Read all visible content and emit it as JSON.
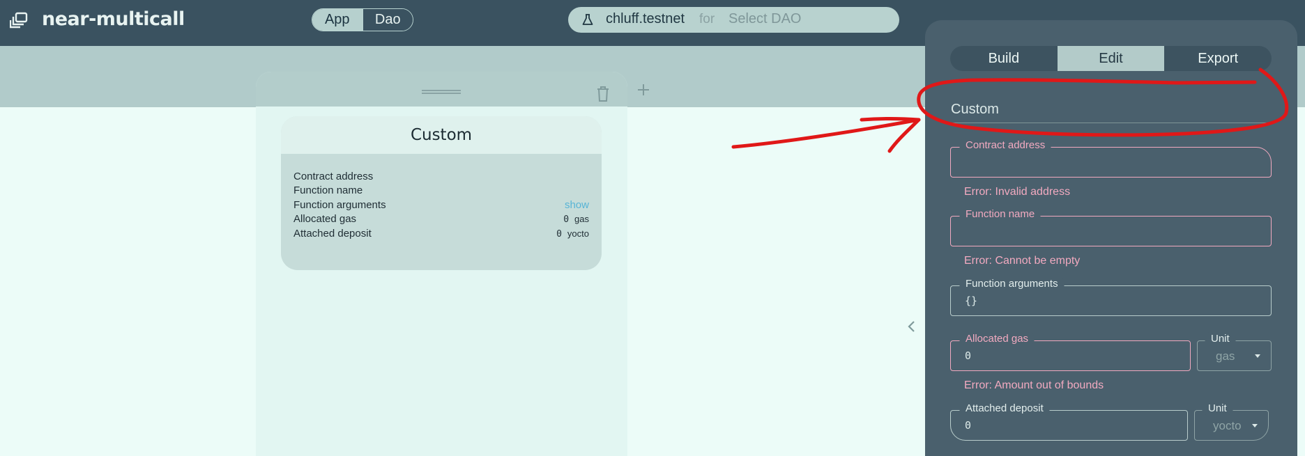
{
  "header": {
    "app_title": "near-multicall",
    "mode_toggle": {
      "app_label": "App",
      "dao_label": "Dao",
      "active": "App"
    },
    "wallet": {
      "account": "chluff.testnet",
      "for_label": "for",
      "dao_placeholder": "Select DAO"
    }
  },
  "column": {
    "task_card": {
      "title": "Custom",
      "rows": {
        "contract_address": "Contract address",
        "function_name": "Function name",
        "function_arguments": "Function arguments",
        "function_arguments_link": "show",
        "allocated_gas": "Allocated gas",
        "allocated_gas_value": "0",
        "allocated_gas_unit": "gas",
        "attached_deposit": "Attached deposit",
        "attached_deposit_value": "0",
        "attached_deposit_unit": "yocto"
      }
    }
  },
  "panel": {
    "tabs": {
      "build": "Build",
      "edit": "Edit",
      "export": "Export",
      "active": "Edit"
    },
    "title": "Custom",
    "fields": {
      "contract_address": {
        "label": "Contract address",
        "value": "",
        "error": "Error: Invalid address"
      },
      "function_name": {
        "label": "Function name",
        "value": "",
        "error": "Error: Cannot be empty"
      },
      "function_arguments": {
        "label": "Function arguments",
        "value": "{}"
      },
      "allocated_gas": {
        "label": "Allocated gas",
        "value": "0",
        "error": "Error: Amount out of bounds",
        "unit_label": "Unit",
        "unit_value": "gas"
      },
      "attached_deposit": {
        "label": "Attached deposit",
        "value": "0",
        "unit_label": "Unit",
        "unit_value": "yocto"
      }
    }
  },
  "colors": {
    "header_bg": "#3a5260",
    "panel_bg": "#4a606d",
    "error": "#f2aac0",
    "link": "#57b4d6",
    "annotation": "#e01818"
  },
  "icons": [
    "multicall-logo-icon",
    "flask-icon",
    "drag-handle-icon",
    "trash-icon",
    "plus-icon",
    "chevron-left-icon",
    "caret-down-icon"
  ]
}
